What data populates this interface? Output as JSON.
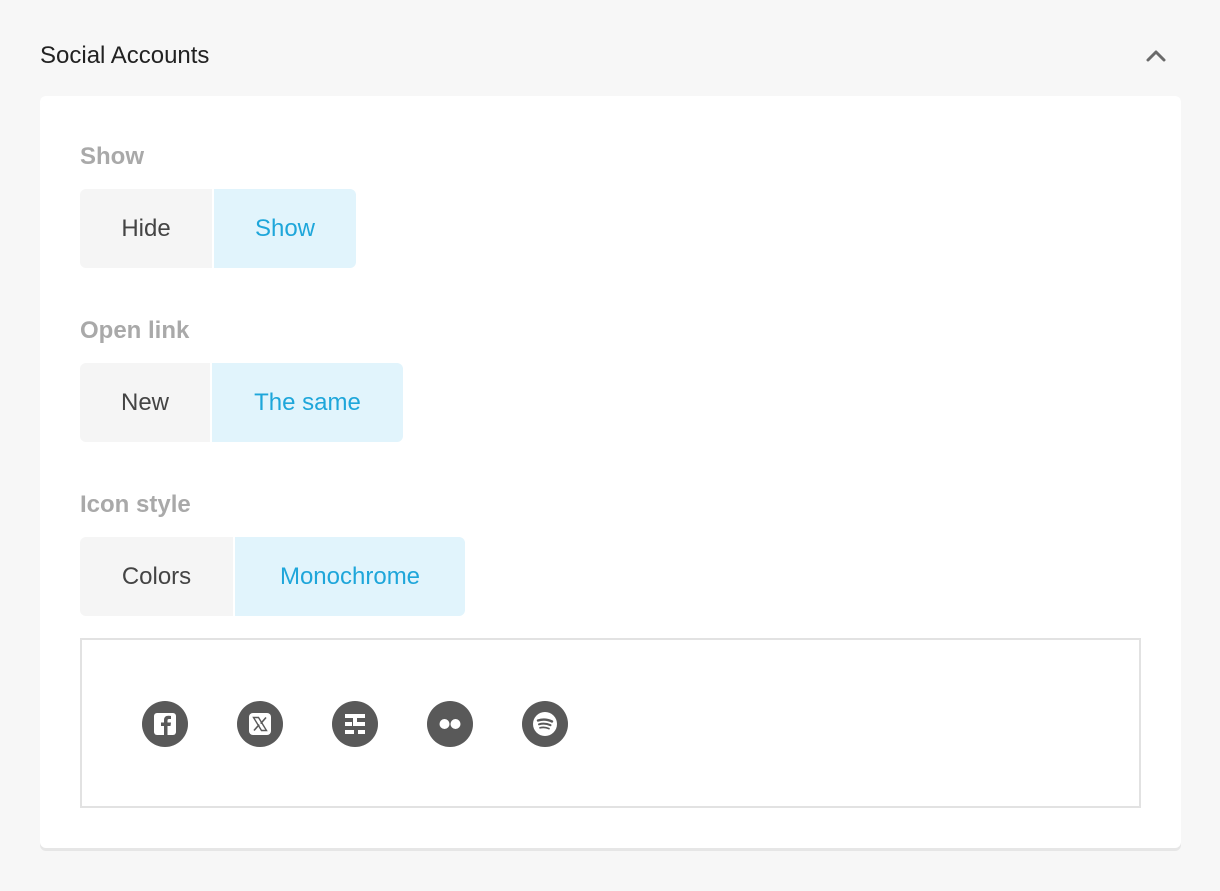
{
  "section": {
    "title": "Social Accounts"
  },
  "show": {
    "label": "Show",
    "options": [
      "Hide",
      "Show"
    ],
    "selected": "Show"
  },
  "open_link": {
    "label": "Open link",
    "options": [
      "New",
      "The same"
    ],
    "selected": "The same"
  },
  "icon_style": {
    "label": "Icon style",
    "options": [
      "Colors",
      "Monochrome"
    ],
    "selected": "Monochrome"
  },
  "preview": {
    "icons": [
      "facebook-icon",
      "x-twitter-icon",
      "discord-like-icon",
      "flickr-icon",
      "spotify-icon"
    ]
  },
  "colors": {
    "accent": "#1ea6da",
    "accent_bg": "#e1f4fc",
    "icon_fill": "#595959"
  }
}
